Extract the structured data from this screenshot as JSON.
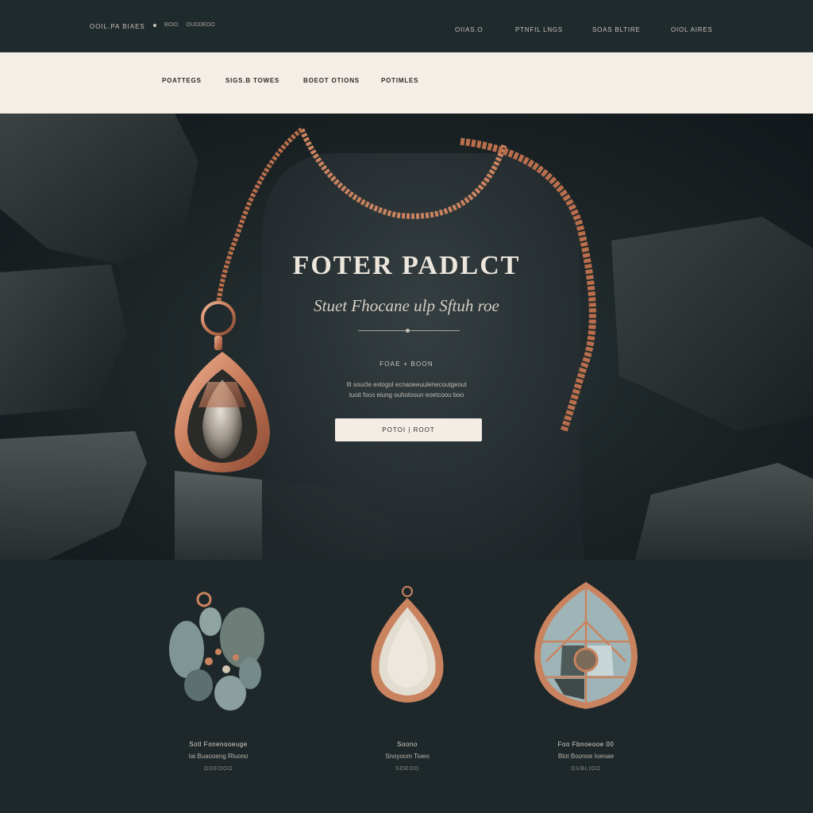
{
  "topbar": {
    "brand": "OOIL.PA BIAES",
    "brand_sub": "BOIO",
    "brand_sub2": "OUDDEOO",
    "links": [
      "OIIAS.O",
      "PTNFIL LNGS",
      "SOAS BLTIRE",
      "OIOL AIRES"
    ]
  },
  "navbar": {
    "links": [
      "POATTEGS",
      "SIGS.B TOWES",
      "BOEOT OTIONS",
      "POTIMLES"
    ]
  },
  "hero": {
    "title": "FOTER PADLCT",
    "subtitle": "Stuet Fhocane ulp Sftuh roe",
    "label": "FOAE + BOON",
    "desc_line1": "Ilt soucle exlogol ecnaoeeuulenecoutgeout",
    "desc_line2": "tuoit foco eiung ouholooun eoetcoou boo",
    "cta": "POTOI | ROOT"
  },
  "products": [
    {
      "name": "Sotl Fonenooeuge",
      "desc": "Iai Buaooeng Rluono",
      "price": "OOEOOO",
      "icon": "stone-cluster-icon"
    },
    {
      "name": "Soono",
      "desc": "Snoyoom Tioeo",
      "price": "SOEOO",
      "icon": "quartz-pendant-icon"
    },
    {
      "name": "Foo Fbnoeooe 00",
      "desc": "Blot Boonoe Ioeoae",
      "price": "OUBLIOO",
      "icon": "mosaic-brooch-icon"
    }
  ],
  "colors": {
    "rose_gold": "#c9835f",
    "dark_bg": "#1e282b",
    "cream": "#f4eee7"
  }
}
